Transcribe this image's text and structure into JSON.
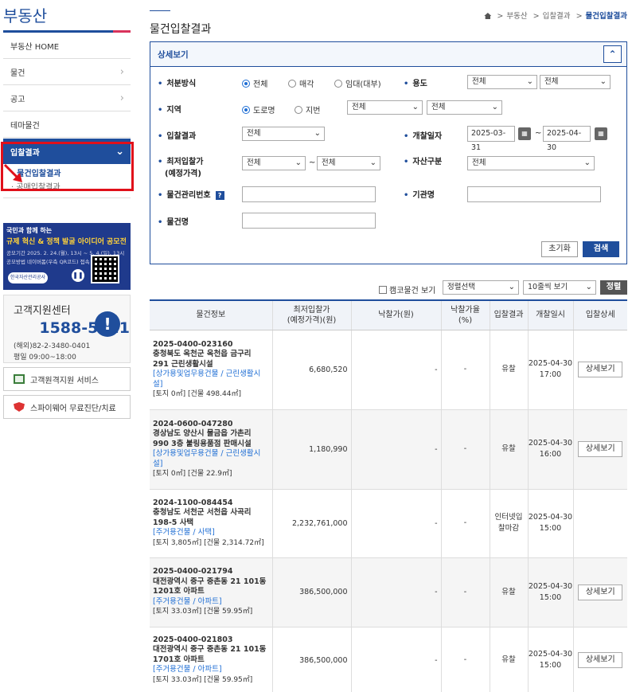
{
  "sidebar": {
    "title": "부동산",
    "items": [
      {
        "label": "부동산 HOME",
        "chevron": false
      },
      {
        "label": "물건",
        "chevron": true
      },
      {
        "label": "공고",
        "chevron": true
      },
      {
        "label": "테마물건",
        "chevron": false
      },
      {
        "label": "입찰결과",
        "chevron": true
      }
    ],
    "sub_items": [
      "물건입찰결과",
      "공매입찰결과"
    ],
    "banner": {
      "line1": "국민과 함께 하는",
      "line2": "규제 혁신 & 정책 발굴 아이디어 공모전",
      "line3": "공모기간 2025. 2. 24.(월), 13시 ~ 5. 4.(일), 13시",
      "line4": "공모방법 네이버폼(우측 QR코드) 접속 후 제출",
      "logo": "한국자산관리공사",
      "pause_icon": "pause-icon"
    },
    "contact": {
      "title": "고객지원센터",
      "phone": "1588-5321",
      "overseas": "(해외)82-2-3480-0401",
      "hours": "평일 09:00~18:00"
    },
    "services": [
      "고객원격지원 서비스",
      "스파이웨어 무료진단/치료"
    ]
  },
  "breadcrumb": [
    "부동산",
    "입찰결과",
    "물건입찰결과"
  ],
  "page_title": "물건입찰결과",
  "panel": {
    "title": "상세보기",
    "disposal_label": "처분방식",
    "disposal_options": [
      "전체",
      "매각",
      "임대(대부)"
    ],
    "usage_label": "용도",
    "usage_sel1": "전체",
    "usage_sel2": "전체",
    "region_label": "지역",
    "region_options": [
      "도로명",
      "지번"
    ],
    "region_sel1": "전체",
    "region_sel2": "전체",
    "result_label": "입찰결과",
    "result_sel": "전체",
    "open_date_label": "개찰일자",
    "date_from": "2025-03-31",
    "date_tilde": "~",
    "date_to": "2025-04-30",
    "min_price_label_1": "최저입찰가",
    "min_price_label_2": "(예정가격)",
    "min_price_from": "전체",
    "min_price_to": "전체",
    "asset_label": "자산구분",
    "asset_sel": "전체",
    "mgmt_no_label": "물건관리번호",
    "help_icon": "?",
    "agency_label": "기관명",
    "item_name_label": "물건명",
    "reset_label": "초기화",
    "search_label": "검색"
  },
  "toolbar": {
    "campaign_label": "캠코물건 보기",
    "sort_sel": "정렬선택",
    "page_size_sel": "10줄씩 보기",
    "sort_button": "정렬"
  },
  "table": {
    "headers": [
      "물건정보",
      "최저입찰가\n(예정가격)(원)",
      "낙찰가(원)",
      "낙찰가율\n(%)",
      "입찰결과",
      "개찰일시",
      "입찰상세"
    ],
    "rows": [
      {
        "no": "2025-0400-023160",
        "name": "충청북도 옥천군 옥천읍 금구리 291 근린생활시설",
        "category": "[상가용및업무용건물 / 근린생활시설]",
        "area": "[토지 0㎡] [건물 498.44㎡]",
        "min_price": "6,680,520",
        "win_price": "-",
        "win_rate": "-",
        "result": "유찰",
        "date": "2025-04-30",
        "time": "17:00",
        "detail": "상세보기"
      },
      {
        "no": "2024-0600-047280",
        "name": "경상남도 양산시 물금읍 가촌리 990 3층 불링용품점 판매시설",
        "category": "[상가용및업무용건물 / 근린생활시설]",
        "area": "[토지 0㎡] [건물 22.9㎡]",
        "min_price": "1,180,990",
        "win_price": "-",
        "win_rate": "-",
        "result": "유찰",
        "date": "2025-04-30",
        "time": "16:00",
        "detail": "상세보기"
      },
      {
        "no": "2024-1100-084454",
        "name": "충청남도 서천군 서천읍 사곡리 198-5 사택",
        "category": "[주거용건물 / 사택]",
        "area": "[토지 3,805㎡] [건물 2,314.72㎡]",
        "min_price": "2,232,761,000",
        "win_price": "-",
        "win_rate": "-",
        "result": "인터넷입찰마감",
        "date": "2025-04-30",
        "time": "15:00",
        "detail": ""
      },
      {
        "no": "2025-0400-021794",
        "name": "대전광역시 중구 중촌동 21 101동 1201호 아파트",
        "category": "[주거용건물 / 아파트]",
        "area": "[토지 33.03㎡] [건물 59.95㎡]",
        "min_price": "386,500,000",
        "win_price": "-",
        "win_rate": "-",
        "result": "유찰",
        "date": "2025-04-30",
        "time": "15:00",
        "detail": "상세보기"
      },
      {
        "no": "2025-0400-021803",
        "name": "대전광역시 중구 중촌동 21 101동 1701호 아파트",
        "category": "[주거용건물 / 아파트]",
        "area": "[토지 33.03㎡] [건물 59.95㎡]",
        "min_price": "386,500,000",
        "win_price": "-",
        "win_rate": "-",
        "result": "유찰",
        "date": "2025-04-30",
        "time": "15:00",
        "detail": "상세보기"
      }
    ]
  }
}
